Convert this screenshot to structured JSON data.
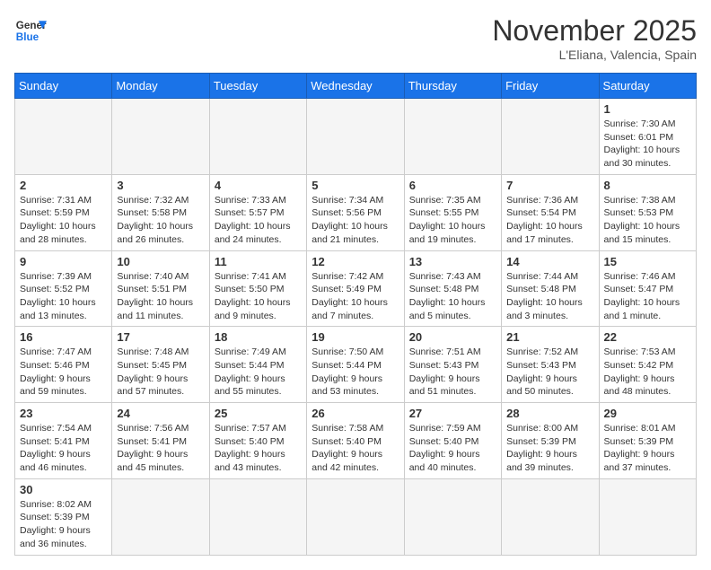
{
  "logo": {
    "text_general": "General",
    "text_blue": "Blue"
  },
  "header": {
    "month": "November 2025",
    "location": "L'Eliana, Valencia, Spain"
  },
  "weekdays": [
    "Sunday",
    "Monday",
    "Tuesday",
    "Wednesday",
    "Thursday",
    "Friday",
    "Saturday"
  ],
  "weeks": [
    [
      {
        "day": "",
        "info": ""
      },
      {
        "day": "",
        "info": ""
      },
      {
        "day": "",
        "info": ""
      },
      {
        "day": "",
        "info": ""
      },
      {
        "day": "",
        "info": ""
      },
      {
        "day": "",
        "info": ""
      },
      {
        "day": "1",
        "info": "Sunrise: 7:30 AM\nSunset: 6:01 PM\nDaylight: 10 hours\nand 30 minutes."
      }
    ],
    [
      {
        "day": "2",
        "info": "Sunrise: 7:31 AM\nSunset: 5:59 PM\nDaylight: 10 hours\nand 28 minutes."
      },
      {
        "day": "3",
        "info": "Sunrise: 7:32 AM\nSunset: 5:58 PM\nDaylight: 10 hours\nand 26 minutes."
      },
      {
        "day": "4",
        "info": "Sunrise: 7:33 AM\nSunset: 5:57 PM\nDaylight: 10 hours\nand 24 minutes."
      },
      {
        "day": "5",
        "info": "Sunrise: 7:34 AM\nSunset: 5:56 PM\nDaylight: 10 hours\nand 21 minutes."
      },
      {
        "day": "6",
        "info": "Sunrise: 7:35 AM\nSunset: 5:55 PM\nDaylight: 10 hours\nand 19 minutes."
      },
      {
        "day": "7",
        "info": "Sunrise: 7:36 AM\nSunset: 5:54 PM\nDaylight: 10 hours\nand 17 minutes."
      },
      {
        "day": "8",
        "info": "Sunrise: 7:38 AM\nSunset: 5:53 PM\nDaylight: 10 hours\nand 15 minutes."
      }
    ],
    [
      {
        "day": "9",
        "info": "Sunrise: 7:39 AM\nSunset: 5:52 PM\nDaylight: 10 hours\nand 13 minutes."
      },
      {
        "day": "10",
        "info": "Sunrise: 7:40 AM\nSunset: 5:51 PM\nDaylight: 10 hours\nand 11 minutes."
      },
      {
        "day": "11",
        "info": "Sunrise: 7:41 AM\nSunset: 5:50 PM\nDaylight: 10 hours\nand 9 minutes."
      },
      {
        "day": "12",
        "info": "Sunrise: 7:42 AM\nSunset: 5:49 PM\nDaylight: 10 hours\nand 7 minutes."
      },
      {
        "day": "13",
        "info": "Sunrise: 7:43 AM\nSunset: 5:48 PM\nDaylight: 10 hours\nand 5 minutes."
      },
      {
        "day": "14",
        "info": "Sunrise: 7:44 AM\nSunset: 5:48 PM\nDaylight: 10 hours\nand 3 minutes."
      },
      {
        "day": "15",
        "info": "Sunrise: 7:46 AM\nSunset: 5:47 PM\nDaylight: 10 hours\nand 1 minute."
      }
    ],
    [
      {
        "day": "16",
        "info": "Sunrise: 7:47 AM\nSunset: 5:46 PM\nDaylight: 9 hours\nand 59 minutes."
      },
      {
        "day": "17",
        "info": "Sunrise: 7:48 AM\nSunset: 5:45 PM\nDaylight: 9 hours\nand 57 minutes."
      },
      {
        "day": "18",
        "info": "Sunrise: 7:49 AM\nSunset: 5:44 PM\nDaylight: 9 hours\nand 55 minutes."
      },
      {
        "day": "19",
        "info": "Sunrise: 7:50 AM\nSunset: 5:44 PM\nDaylight: 9 hours\nand 53 minutes."
      },
      {
        "day": "20",
        "info": "Sunrise: 7:51 AM\nSunset: 5:43 PM\nDaylight: 9 hours\nand 51 minutes."
      },
      {
        "day": "21",
        "info": "Sunrise: 7:52 AM\nSunset: 5:43 PM\nDaylight: 9 hours\nand 50 minutes."
      },
      {
        "day": "22",
        "info": "Sunrise: 7:53 AM\nSunset: 5:42 PM\nDaylight: 9 hours\nand 48 minutes."
      }
    ],
    [
      {
        "day": "23",
        "info": "Sunrise: 7:54 AM\nSunset: 5:41 PM\nDaylight: 9 hours\nand 46 minutes."
      },
      {
        "day": "24",
        "info": "Sunrise: 7:56 AM\nSunset: 5:41 PM\nDaylight: 9 hours\nand 45 minutes."
      },
      {
        "day": "25",
        "info": "Sunrise: 7:57 AM\nSunset: 5:40 PM\nDaylight: 9 hours\nand 43 minutes."
      },
      {
        "day": "26",
        "info": "Sunrise: 7:58 AM\nSunset: 5:40 PM\nDaylight: 9 hours\nand 42 minutes."
      },
      {
        "day": "27",
        "info": "Sunrise: 7:59 AM\nSunset: 5:40 PM\nDaylight: 9 hours\nand 40 minutes."
      },
      {
        "day": "28",
        "info": "Sunrise: 8:00 AM\nSunset: 5:39 PM\nDaylight: 9 hours\nand 39 minutes."
      },
      {
        "day": "29",
        "info": "Sunrise: 8:01 AM\nSunset: 5:39 PM\nDaylight: 9 hours\nand 37 minutes."
      }
    ],
    [
      {
        "day": "30",
        "info": "Sunrise: 8:02 AM\nSunset: 5:39 PM\nDaylight: 9 hours\nand 36 minutes."
      },
      {
        "day": "",
        "info": ""
      },
      {
        "day": "",
        "info": ""
      },
      {
        "day": "",
        "info": ""
      },
      {
        "day": "",
        "info": ""
      },
      {
        "day": "",
        "info": ""
      },
      {
        "day": "",
        "info": ""
      }
    ]
  ]
}
